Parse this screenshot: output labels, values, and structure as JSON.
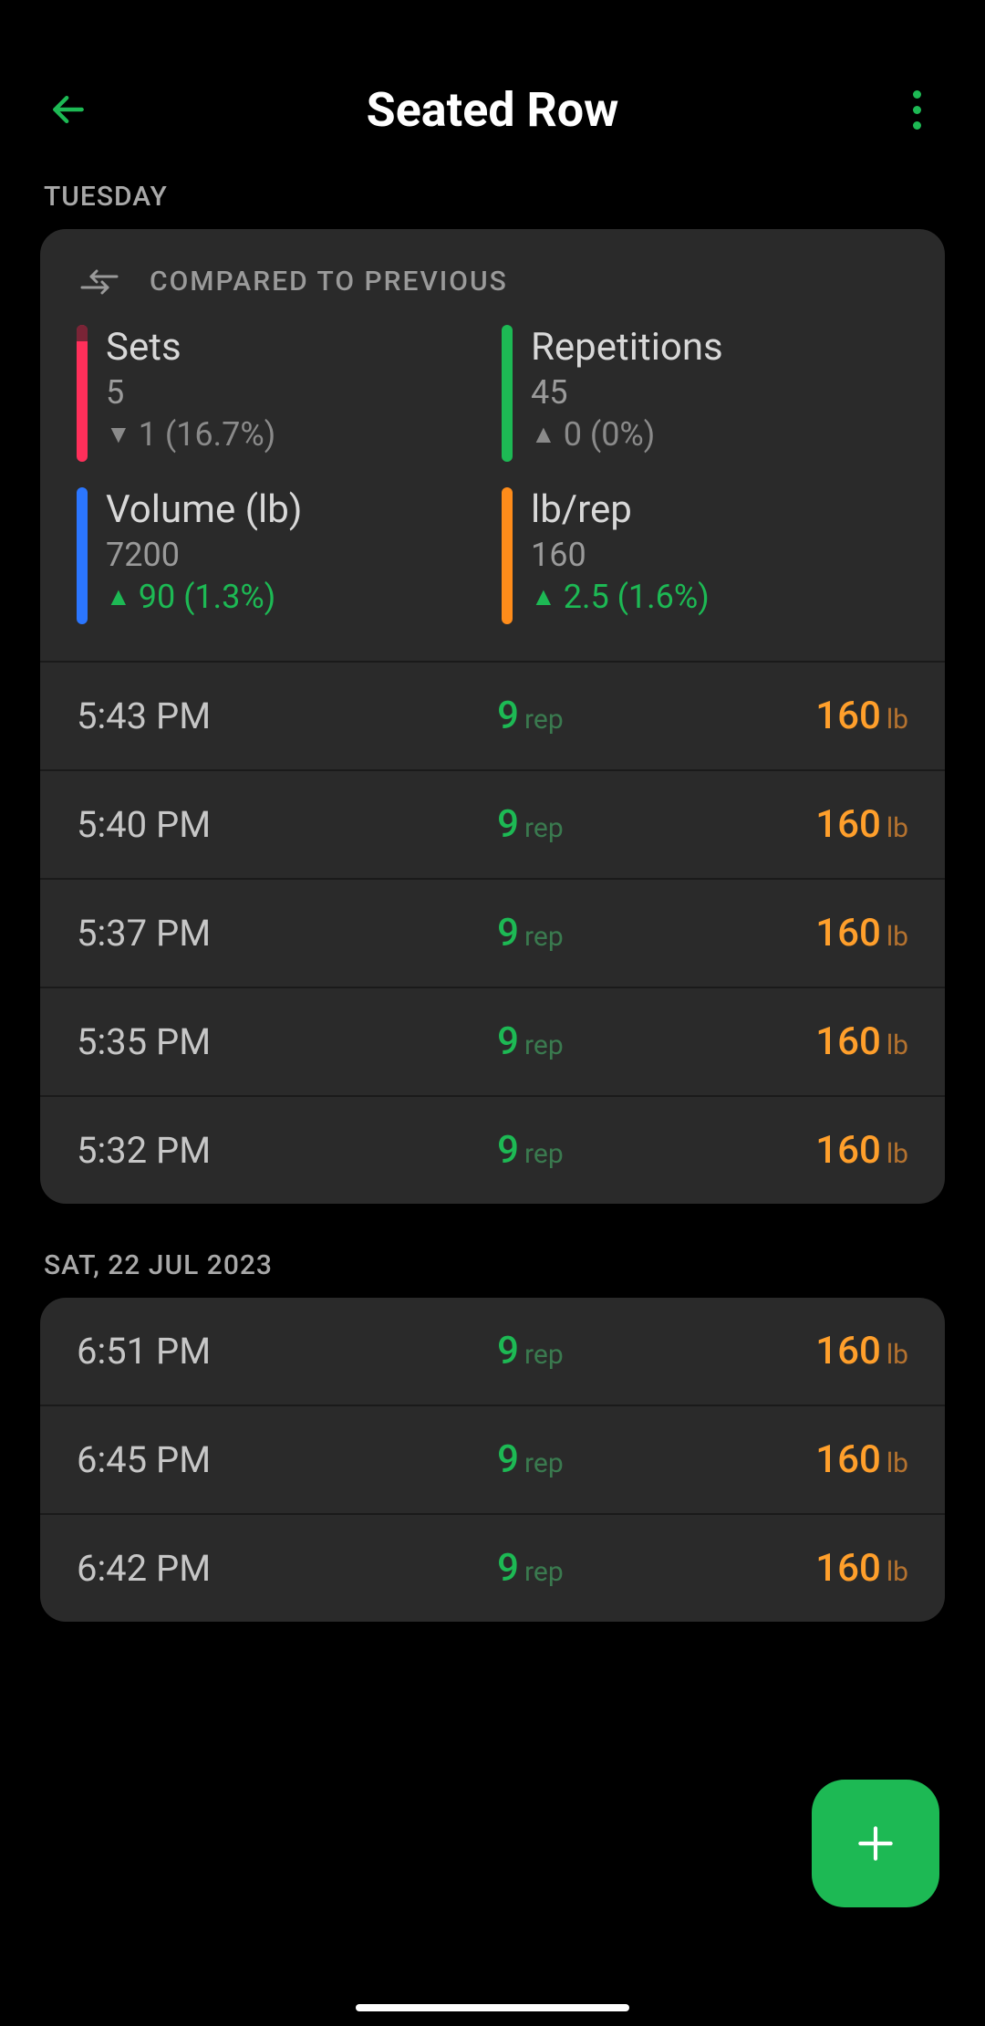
{
  "header": {
    "title": "Seated Row"
  },
  "sections": [
    {
      "day_label": "TUESDAY",
      "has_compare": true,
      "compare_label": "COMPARED TO PREVIOUS",
      "stats": [
        {
          "color": "pink",
          "title": "Sets",
          "value": "5",
          "delta_dir": "down",
          "delta_text": "1 (16.7%)"
        },
        {
          "color": "green",
          "title": "Repetitions",
          "value": "45",
          "delta_dir": "neutral",
          "delta_text": "0 (0%)"
        },
        {
          "color": "blue",
          "title": "Volume (lb)",
          "value": "7200",
          "delta_dir": "up",
          "delta_text": "90 (1.3%)"
        },
        {
          "color": "orange",
          "title": "lb/rep",
          "value": "160",
          "delta_dir": "up",
          "delta_text": "2.5 (1.6%)"
        }
      ],
      "sets": [
        {
          "time": "5:43 PM",
          "reps": "9",
          "rep_unit": "rep",
          "weight": "160",
          "wt_unit": "lb"
        },
        {
          "time": "5:40 PM",
          "reps": "9",
          "rep_unit": "rep",
          "weight": "160",
          "wt_unit": "lb"
        },
        {
          "time": "5:37 PM",
          "reps": "9",
          "rep_unit": "rep",
          "weight": "160",
          "wt_unit": "lb"
        },
        {
          "time": "5:35 PM",
          "reps": "9",
          "rep_unit": "rep",
          "weight": "160",
          "wt_unit": "lb"
        },
        {
          "time": "5:32 PM",
          "reps": "9",
          "rep_unit": "rep",
          "weight": "160",
          "wt_unit": "lb"
        }
      ]
    },
    {
      "day_label": "SAT, 22 JUL 2023",
      "has_compare": false,
      "sets": [
        {
          "time": "6:51 PM",
          "reps": "9",
          "rep_unit": "rep",
          "weight": "160",
          "wt_unit": "lb"
        },
        {
          "time": "6:45 PM",
          "reps": "9",
          "rep_unit": "rep",
          "weight": "160",
          "wt_unit": "lb"
        },
        {
          "time": "6:42 PM",
          "reps": "9",
          "rep_unit": "rep",
          "weight": "160",
          "wt_unit": "lb"
        }
      ]
    }
  ]
}
